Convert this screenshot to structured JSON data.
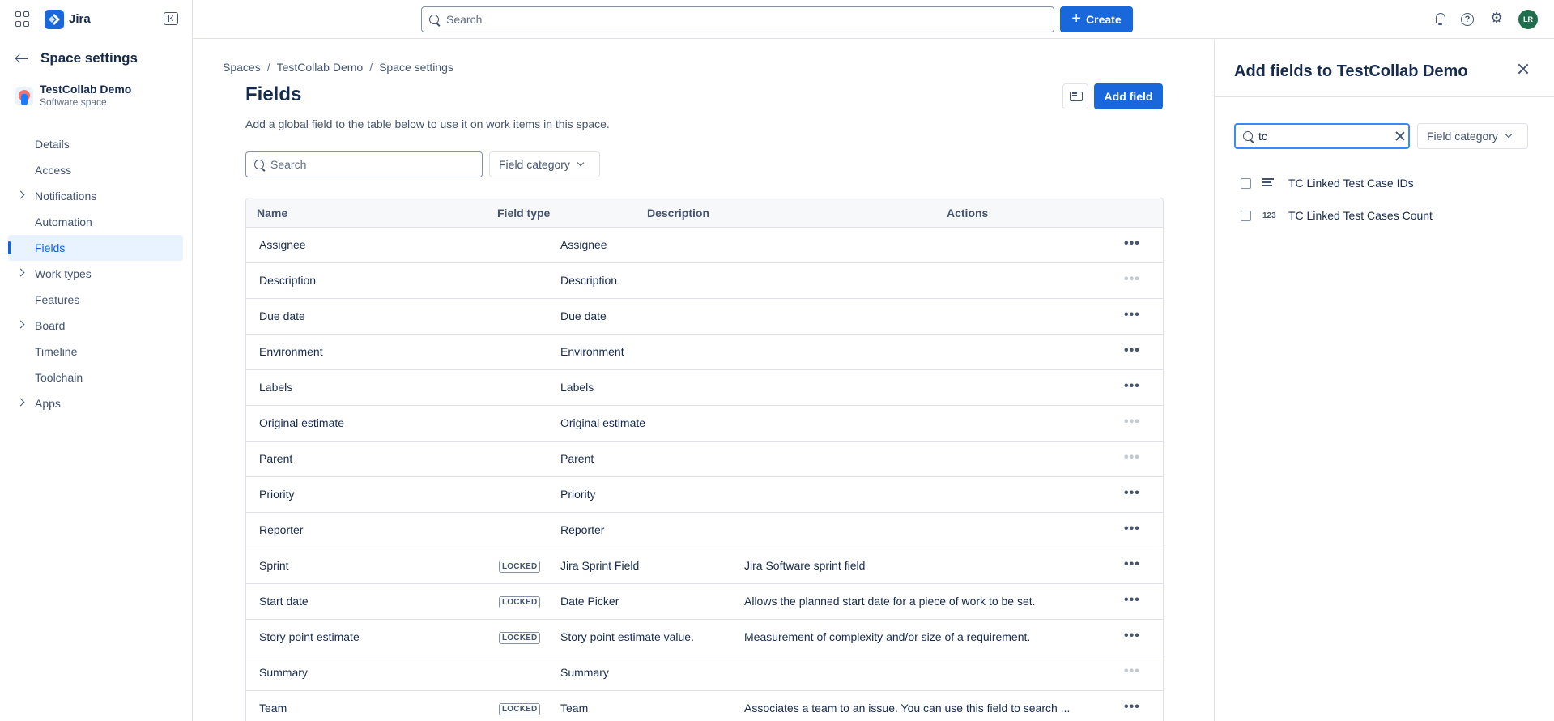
{
  "app": {
    "name": "Jira"
  },
  "topbar": {
    "search_placeholder": "Search",
    "create_label": "Create",
    "avatar_initials": "LR"
  },
  "sidebar": {
    "title": "Space settings",
    "project_name": "TestCollab Demo",
    "project_type": "Software space",
    "items": [
      {
        "label": "Details",
        "expandable": false,
        "active": false
      },
      {
        "label": "Access",
        "expandable": false,
        "active": false
      },
      {
        "label": "Notifications",
        "expandable": true,
        "active": false
      },
      {
        "label": "Automation",
        "expandable": false,
        "active": false
      },
      {
        "label": "Fields",
        "expandable": false,
        "active": true
      },
      {
        "label": "Work types",
        "expandable": true,
        "active": false
      },
      {
        "label": "Features",
        "expandable": false,
        "active": false
      },
      {
        "label": "Board",
        "expandable": true,
        "active": false
      },
      {
        "label": "Timeline",
        "expandable": false,
        "active": false
      },
      {
        "label": "Toolchain",
        "expandable": false,
        "active": false
      },
      {
        "label": "Apps",
        "expandable": true,
        "active": false
      }
    ]
  },
  "main": {
    "breadcrumb": [
      "Spaces",
      "TestCollab Demo",
      "Space settings"
    ],
    "title": "Fields",
    "description": "Add a global field to the table below to use it on work items in this space.",
    "add_field_label": "Add field",
    "search_placeholder": "Search",
    "category_label": "Field category",
    "columns": {
      "name": "Name",
      "type": "Field type",
      "description": "Description",
      "actions": "Actions"
    },
    "rows": [
      {
        "name": "Assignee",
        "locked": false,
        "type": "Assignee",
        "description": "",
        "actions_enabled": true
      },
      {
        "name": "Description",
        "locked": false,
        "type": "Description",
        "description": "",
        "actions_enabled": false
      },
      {
        "name": "Due date",
        "locked": false,
        "type": "Due date",
        "description": "",
        "actions_enabled": true
      },
      {
        "name": "Environment",
        "locked": false,
        "type": "Environment",
        "description": "",
        "actions_enabled": true
      },
      {
        "name": "Labels",
        "locked": false,
        "type": "Labels",
        "description": "",
        "actions_enabled": true
      },
      {
        "name": "Original estimate",
        "locked": false,
        "type": "Original estimate",
        "description": "",
        "actions_enabled": false
      },
      {
        "name": "Parent",
        "locked": false,
        "type": "Parent",
        "description": "",
        "actions_enabled": false
      },
      {
        "name": "Priority",
        "locked": false,
        "type": "Priority",
        "description": "",
        "actions_enabled": true
      },
      {
        "name": "Reporter",
        "locked": false,
        "type": "Reporter",
        "description": "",
        "actions_enabled": true
      },
      {
        "name": "Sprint",
        "locked": true,
        "type": "Jira Sprint Field",
        "description": "Jira Software sprint field",
        "actions_enabled": true
      },
      {
        "name": "Start date",
        "locked": true,
        "type": "Date Picker",
        "description": "Allows the planned start date for a piece of work to be set.",
        "actions_enabled": true
      },
      {
        "name": "Story point estimate",
        "locked": true,
        "type": "Story point estimate value.",
        "description": "Measurement of complexity and/or size of a requirement.",
        "actions_enabled": true
      },
      {
        "name": "Summary",
        "locked": false,
        "type": "Summary",
        "description": "",
        "actions_enabled": false
      },
      {
        "name": "Team",
        "locked": true,
        "type": "Team",
        "description": "Associates a team to an issue. You can use this field to search ...",
        "actions_enabled": true
      }
    ],
    "locked_label": "LOCKED"
  },
  "panel": {
    "title": "Add fields to TestCollab Demo",
    "search_value": "tc",
    "category_label": "Field category",
    "items": [
      {
        "label": "TC Linked Test Case IDs",
        "icon": "paragraph-icon"
      },
      {
        "label": "TC Linked Test Cases Count",
        "icon": "number-icon",
        "icon_text": "123"
      }
    ]
  }
}
